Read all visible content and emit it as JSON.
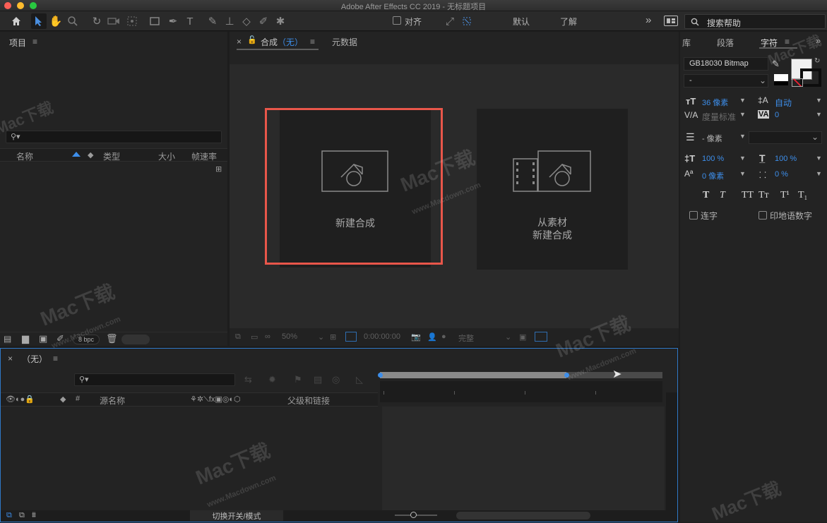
{
  "window": {
    "title": "Adobe After Effects CC 2019 - 无标题项目"
  },
  "toolbar": {
    "align_label": "对齐",
    "workspace_default": "默认",
    "workspace_learn": "了解",
    "more": "»",
    "search_placeholder": "搜索帮助"
  },
  "project": {
    "title": "项目",
    "menu": "≡",
    "columns": [
      "名称",
      "类型",
      "大小",
      "帧速率"
    ],
    "bpc": "8 bpc"
  },
  "composition": {
    "tab_prefix": "合成",
    "tab_name": "（无）",
    "tab_metadata": "元数据",
    "cards": [
      {
        "label": "新建合成"
      },
      {
        "label_line1": "从素材",
        "label_line2": "新建合成"
      }
    ],
    "footer": {
      "zoom": "50%",
      "timecode": "0:00:00:00",
      "resolution": "完整"
    }
  },
  "character": {
    "tabs": [
      "库",
      "段落",
      "字符"
    ],
    "font_family": "GB18030 Bitmap",
    "font_style": "-",
    "font_size": "36 像素",
    "leading": "自动",
    "kerning": "度量标准",
    "tracking": "0",
    "stroke": "- 像素",
    "vscale": "100 %",
    "hscale": "100 %",
    "baseline": "0 像素",
    "tsume": "0 %",
    "styles": [
      "T",
      "T",
      "TT",
      "Tт",
      "T¹",
      "T₁"
    ],
    "ligature": "连字",
    "hindi_digits": "印地语数字",
    "colors": {
      "fill": "#f0f0f0",
      "stroke": "#1a1a1a",
      "accent": "#3d8eea"
    }
  },
  "timeline": {
    "comp_name": "（无）",
    "columns": {
      "source_name": "源名称",
      "parent": "父级和链接",
      "hash": "#"
    },
    "footer_toggle": "切换开关/模式"
  },
  "highlight_color": "#e8564a",
  "watermark": {
    "brand": "Mac下载",
    "url": "www.Macdown.com"
  }
}
